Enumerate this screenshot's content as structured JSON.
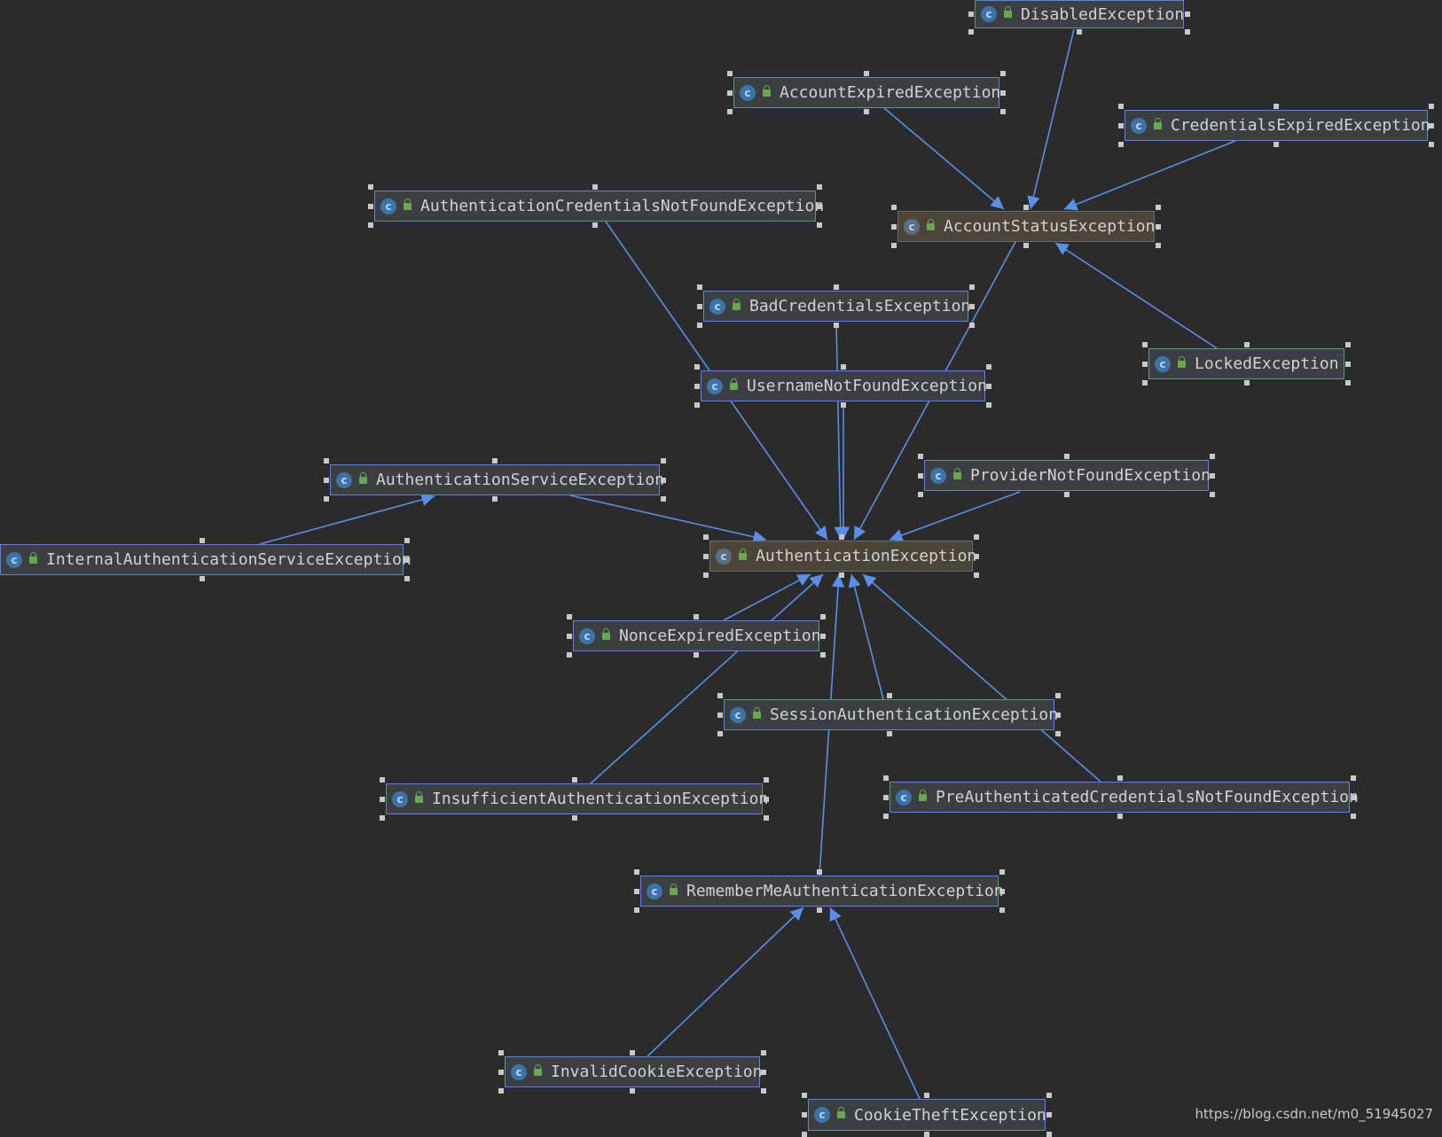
{
  "diagram": {
    "nodes": [
      {
        "id": "DisabledException",
        "label": "DisabledException",
        "kind": "class"
      },
      {
        "id": "AccountExpiredException",
        "label": "AccountExpiredException",
        "kind": "class"
      },
      {
        "id": "CredentialsExpiredException",
        "label": "CredentialsExpiredException",
        "kind": "class"
      },
      {
        "id": "AuthenticationCredentialsNotFoundException",
        "label": "AuthenticationCredentialsNotFoundException",
        "kind": "class"
      },
      {
        "id": "AccountStatusException",
        "label": "AccountStatusException",
        "kind": "abstract"
      },
      {
        "id": "BadCredentialsException",
        "label": "BadCredentialsException",
        "kind": "class"
      },
      {
        "id": "LockedException",
        "label": "LockedException",
        "kind": "class"
      },
      {
        "id": "UsernameNotFoundException",
        "label": "UsernameNotFoundException",
        "kind": "class"
      },
      {
        "id": "AuthenticationServiceException",
        "label": "AuthenticationServiceException",
        "kind": "class"
      },
      {
        "id": "ProviderNotFoundException",
        "label": "ProviderNotFoundException",
        "kind": "class"
      },
      {
        "id": "InternalAuthenticationServiceException",
        "label": "InternalAuthenticationServiceException",
        "kind": "class"
      },
      {
        "id": "AuthenticationException",
        "label": "AuthenticationException",
        "kind": "abstract"
      },
      {
        "id": "NonceExpiredException",
        "label": "NonceExpiredException",
        "kind": "class"
      },
      {
        "id": "SessionAuthenticationException",
        "label": "SessionAuthenticationException",
        "kind": "class"
      },
      {
        "id": "InsufficientAuthenticationException",
        "label": "InsufficientAuthenticationException",
        "kind": "class"
      },
      {
        "id": "PreAuthenticatedCredentialsNotFoundException",
        "label": "PreAuthenticatedCredentialsNotFoundException",
        "kind": "class"
      },
      {
        "id": "RememberMeAuthenticationException",
        "label": "RememberMeAuthenticationException",
        "kind": "class"
      },
      {
        "id": "InvalidCookieException",
        "label": "InvalidCookieException",
        "kind": "class"
      },
      {
        "id": "CookieTheftException",
        "label": "CookieTheftException",
        "kind": "class"
      }
    ],
    "edges": [
      {
        "from": "DisabledException",
        "to": "AccountStatusException"
      },
      {
        "from": "AccountExpiredException",
        "to": "AccountStatusException"
      },
      {
        "from": "CredentialsExpiredException",
        "to": "AccountStatusException"
      },
      {
        "from": "LockedException",
        "to": "AccountStatusException"
      },
      {
        "from": "AuthenticationCredentialsNotFoundException",
        "to": "AuthenticationException"
      },
      {
        "from": "AccountStatusException",
        "to": "AuthenticationException"
      },
      {
        "from": "BadCredentialsException",
        "to": "AuthenticationException"
      },
      {
        "from": "UsernameNotFoundException",
        "to": "AuthenticationException"
      },
      {
        "from": "AuthenticationServiceException",
        "to": "AuthenticationException"
      },
      {
        "from": "InternalAuthenticationServiceException",
        "to": "AuthenticationServiceException"
      },
      {
        "from": "ProviderNotFoundException",
        "to": "AuthenticationException"
      },
      {
        "from": "NonceExpiredException",
        "to": "AuthenticationException"
      },
      {
        "from": "InsufficientAuthenticationException",
        "to": "AuthenticationException"
      },
      {
        "from": "SessionAuthenticationException",
        "to": "AuthenticationException"
      },
      {
        "from": "PreAuthenticatedCredentialsNotFoundException",
        "to": "AuthenticationException"
      },
      {
        "from": "RememberMeAuthenticationException",
        "to": "AuthenticationException"
      },
      {
        "from": "InvalidCookieException",
        "to": "RememberMeAuthenticationException"
      },
      {
        "from": "CookieTheftException",
        "to": "RememberMeAuthenticationException"
      }
    ],
    "colors": {
      "edge": "#5b8ee6",
      "background": "#2b2b2b"
    }
  },
  "watermark": "https://blog.csdn.net/m0_51945027"
}
